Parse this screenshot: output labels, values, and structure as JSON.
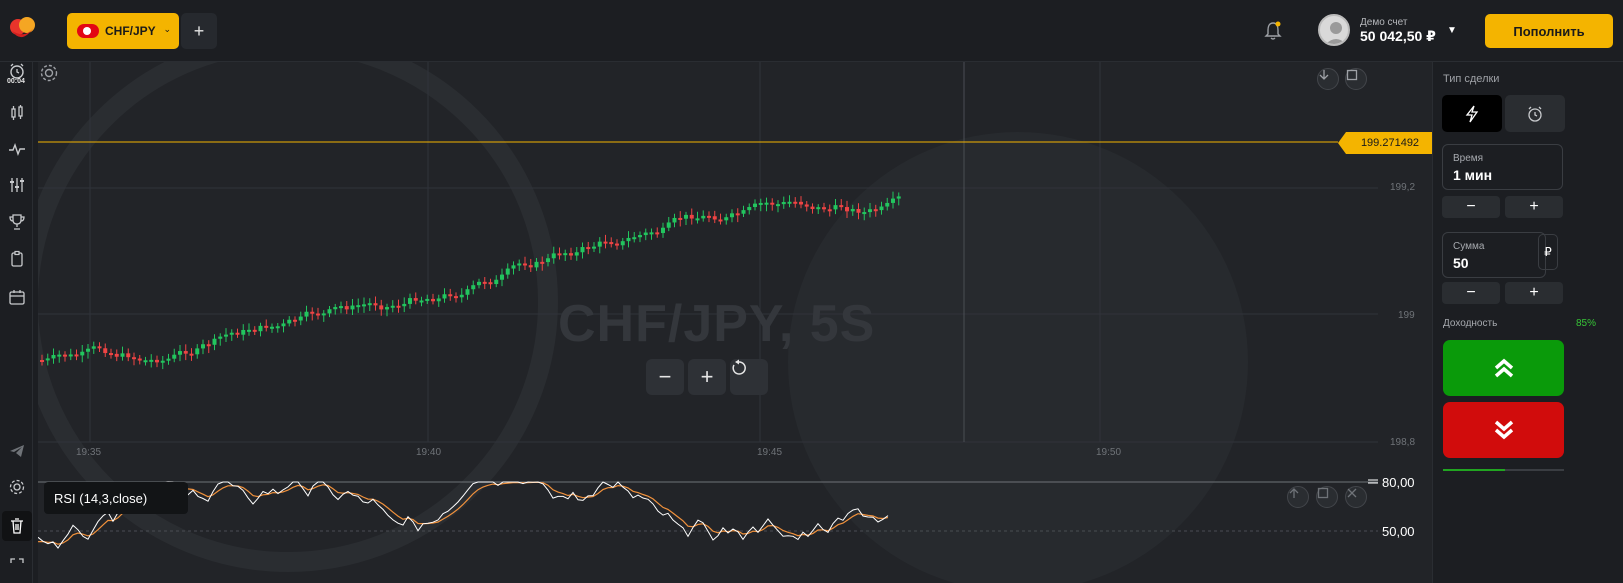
{
  "header": {
    "asset_tab": "CHF/JPY",
    "add_tab": "+",
    "account_label": "Демо счет",
    "account_balance": "50 042,50 ₽",
    "deposit_label": "Пополнить"
  },
  "sidebar": {
    "timer": "00:04"
  },
  "chart": {
    "watermark": "CHF/JPY, 5S",
    "current_price": "199.271492",
    "y_ticks": [
      "199,2",
      "199",
      "198,8"
    ],
    "x_ticks": [
      "19:35",
      "19:40",
      "19:45",
      "19:50"
    ],
    "zoom_out": "−",
    "zoom_in": "+",
    "rsi_label": "RSI (14,3,close)",
    "rsi_levels": [
      "80,00",
      "50,00"
    ],
    "colors": {
      "up": "#22c55e",
      "down": "#ef4444",
      "price_line": "#f4b400",
      "rsi_main": "#ffffff",
      "rsi_signal": "#f0913c"
    }
  },
  "panel": {
    "trade_type_title": "Тип сделки",
    "time_label": "Время",
    "time_value": "1 мин",
    "minus": "−",
    "plus": "+",
    "amount_label": "Сумма",
    "amount_value": "50",
    "currency": "₽",
    "yield_label": "Доходность",
    "yield_value": "85%",
    "up_color": "#0a9a0a",
    "down_color": "#d10c0c"
  }
}
